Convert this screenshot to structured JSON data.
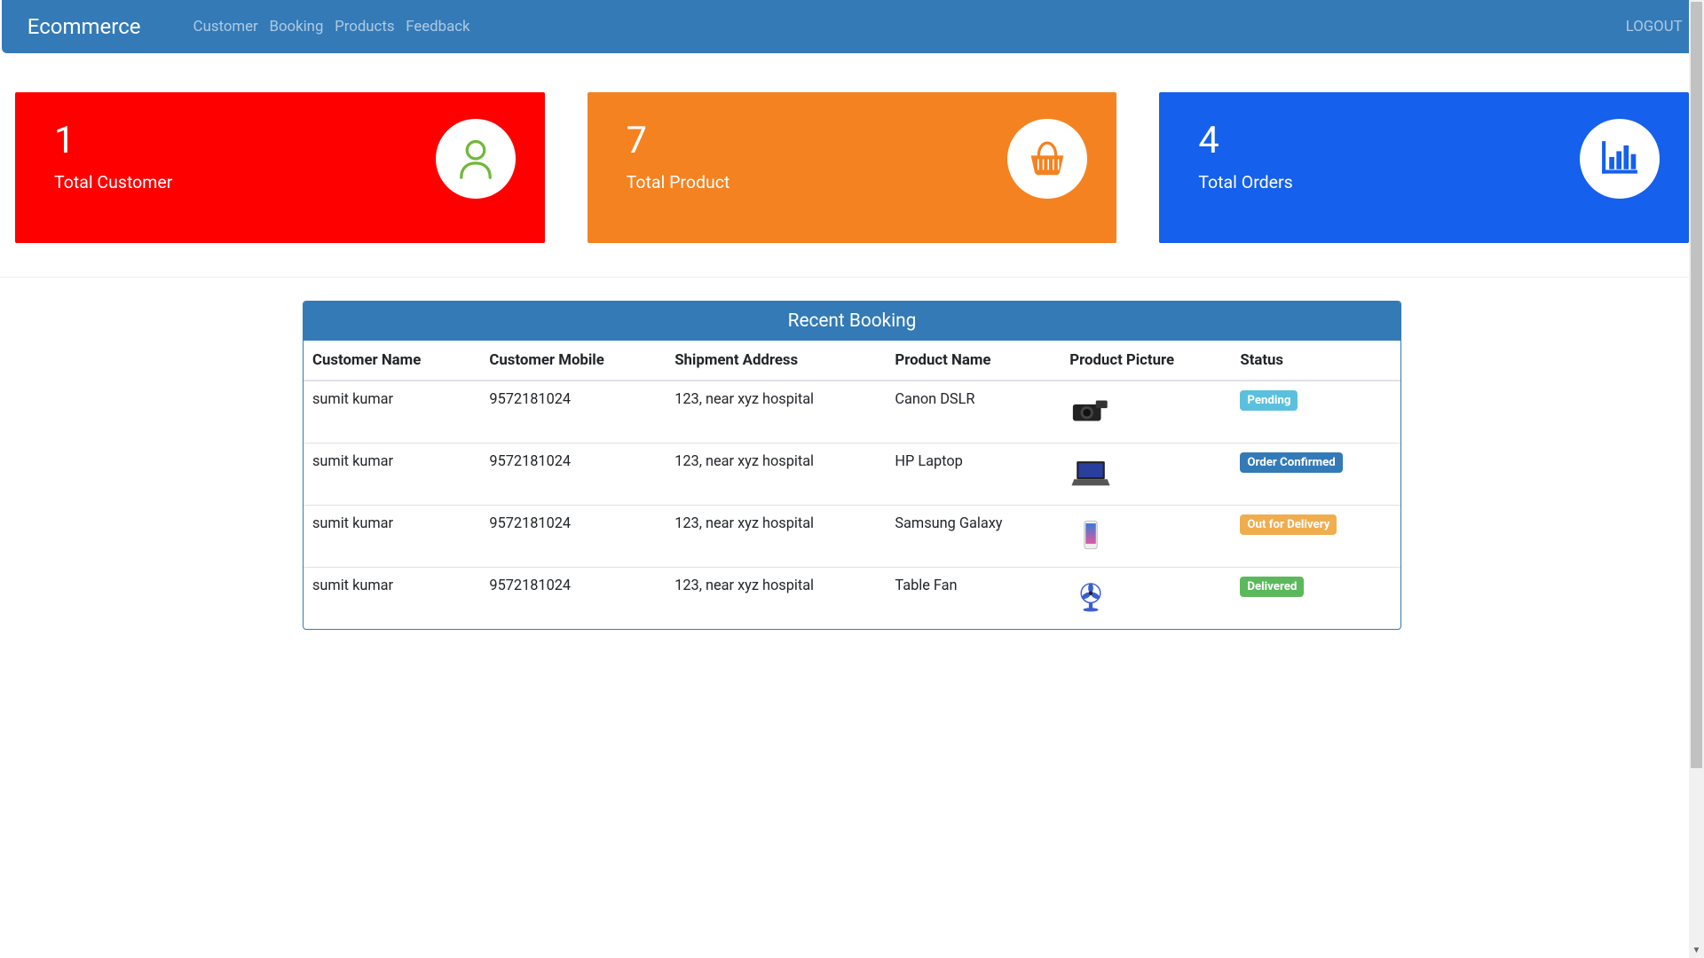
{
  "navbar": {
    "brand": "Ecommerce",
    "links": [
      "Customer",
      "Booking",
      "Products",
      "Feedback"
    ],
    "logout": "LOGOUT"
  },
  "stats": [
    {
      "value": "1",
      "label": "Total Customer",
      "color": "red",
      "icon": "user"
    },
    {
      "value": "7",
      "label": "Total Product",
      "color": "orange",
      "icon": "cart"
    },
    {
      "value": "4",
      "label": "Total Orders",
      "color": "blue",
      "icon": "bars"
    }
  ],
  "table": {
    "title": "Recent Booking",
    "columns": [
      "Customer Name",
      "Customer Mobile",
      "Shipment Address",
      "Product Name",
      "Product Picture",
      "Status"
    ],
    "rows": [
      {
        "customer": "sumit kumar",
        "mobile": "9572181024",
        "address": "123, near xyz hospital",
        "product": "Canon DSLR",
        "pic": "camera",
        "status": "Pending",
        "badge": "pending"
      },
      {
        "customer": "sumit kumar",
        "mobile": "9572181024",
        "address": "123, near xyz hospital",
        "product": "HP Laptop",
        "pic": "laptop",
        "status": "Order Confirmed",
        "badge": "confirmed"
      },
      {
        "customer": "sumit kumar",
        "mobile": "9572181024",
        "address": "123, near xyz hospital",
        "product": "Samsung Galaxy",
        "pic": "phone",
        "status": "Out for Delivery",
        "badge": "out"
      },
      {
        "customer": "sumit kumar",
        "mobile": "9572181024",
        "address": "123, near xyz hospital",
        "product": "Table Fan",
        "pic": "fan",
        "status": "Delivered",
        "badge": "delivered"
      }
    ]
  }
}
